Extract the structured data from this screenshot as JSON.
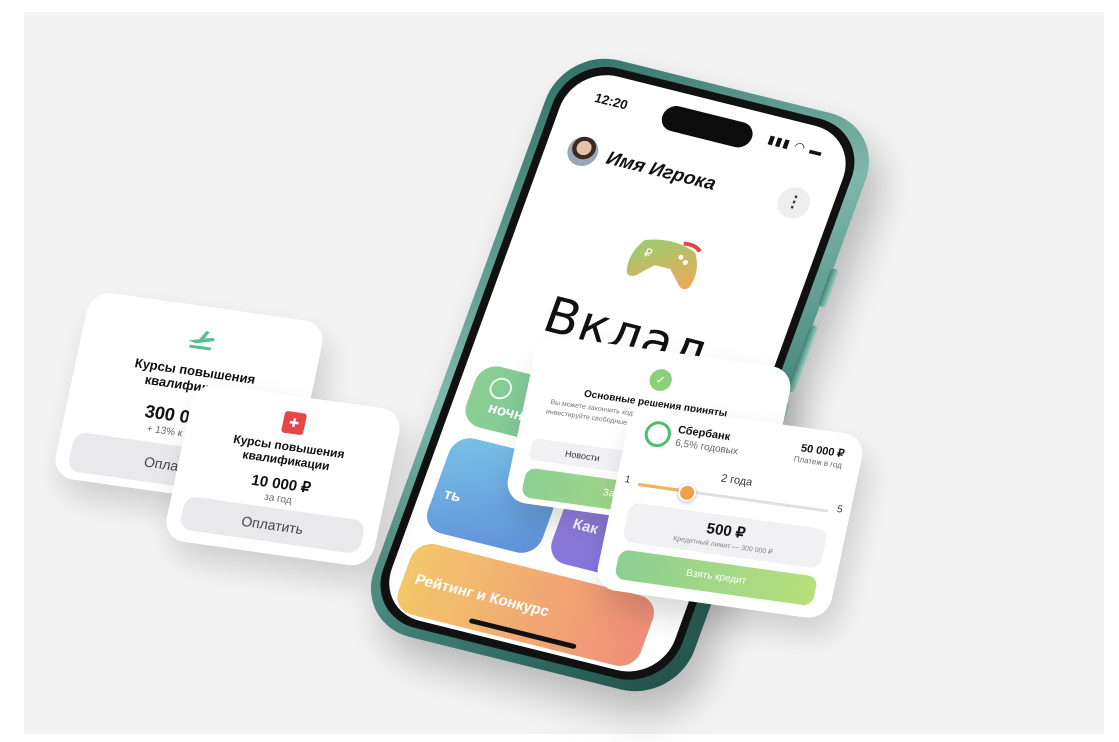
{
  "phone": {
    "status_time": "12:20",
    "player_name": "Имя Игрока",
    "menu_glyph": "⋮",
    "logo_word": "Вклад",
    "tiles": [
      {
        "label": "ночная игра",
        "color": "#5db6a5"
      },
      {
        "label": "ть",
        "color": "#5f8fd9"
      },
      {
        "label": "Как",
        "color": "#7a6fd8"
      },
      {
        "label": "Рейтинг и Конкурс",
        "color": "#f08f7a"
      }
    ]
  },
  "card_left": {
    "icon": "plane-icon",
    "title": "Курсы повышения квалификации",
    "amount": "300 000 ₽",
    "note": "+ 13% к зарпла",
    "button": "Оплатить"
  },
  "card_mid": {
    "icon": "first-aid-icon",
    "title": "Курсы повышения квалификации",
    "amount": "10 000 ₽",
    "note": "за год",
    "button": "Оплатить"
  },
  "card_decision": {
    "title": "Основные решения приняты",
    "body": "Вы можете закончить ход, но перед этим посмотрите новости и инвестируйте свободные средства, в также... странице и образ...",
    "chips": [
      "Новости",
      ""
    ],
    "button": "Закончить ход"
  },
  "card_sber": {
    "bank": "Сбербанк",
    "rate": "6,5% годовых",
    "payment": "50 000 ₽",
    "payment_note": "Платеж в год",
    "term": "2 года",
    "slider_min": "1",
    "slider_max": "5",
    "slider_value": 0.25,
    "amount": "500 ₽",
    "amount_note": "Кредитный лимит — 300 000 ₽",
    "button": "Взять кредит"
  }
}
